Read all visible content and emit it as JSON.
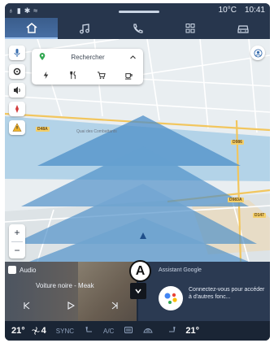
{
  "status": {
    "temperature": "10°C",
    "time": "10:41"
  },
  "tabs": [
    {
      "icon": "home-icon",
      "active": true
    },
    {
      "icon": "music-icon",
      "active": false
    },
    {
      "icon": "phone-icon",
      "active": false
    },
    {
      "icon": "apps-grid-icon",
      "active": false
    },
    {
      "icon": "car-icon",
      "active": false
    }
  ],
  "map": {
    "search_label": "Rechercher",
    "categories": [
      "charging-icon",
      "restaurant-icon",
      "shopping-icon",
      "cafe-icon"
    ],
    "road_labels": [
      "D48A",
      "D986",
      "D983A",
      "D147"
    ],
    "streets": [
      "Quai des Combattants"
    ],
    "zoom_in": "+",
    "zoom_out": "−"
  },
  "audio": {
    "source": "Audio",
    "track": "Voiture noire - Meak"
  },
  "assistant": {
    "header": "Assistant Google",
    "message": "Connectez-vous pour accéder à d'autres fonc..."
  },
  "callout": "A",
  "climate": {
    "left_temp": "21°",
    "fan_level": "4",
    "sync": "SYNC",
    "ac": "A/C",
    "right_temp": "21°"
  },
  "colors": {
    "accent": "#476ea3",
    "map_water": "#b3d3e8",
    "nav_cone": "#4d8fc9"
  }
}
